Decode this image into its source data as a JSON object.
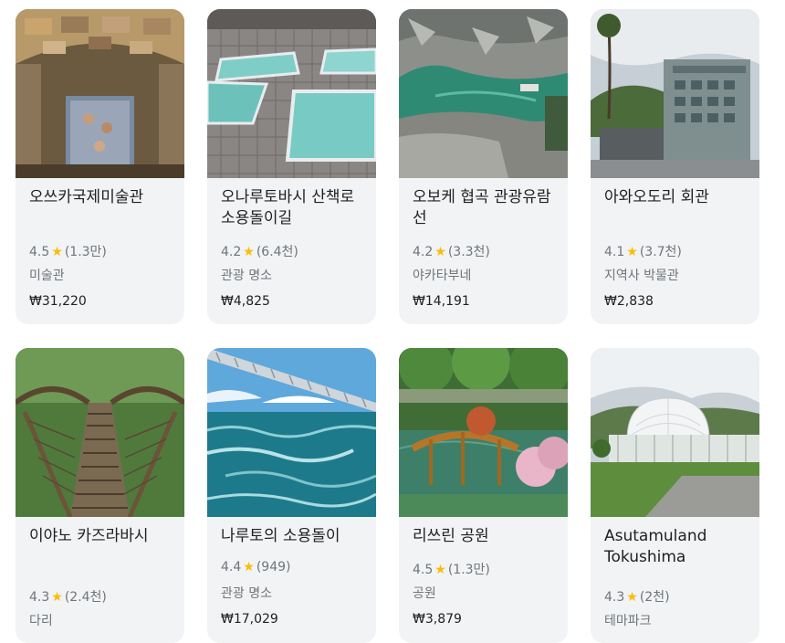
{
  "cards": [
    {
      "title": "오쓰카국제미술관",
      "rating": "4.5",
      "reviews": "(1.3만)",
      "category": "미술관",
      "price": "₩31,220",
      "image": "painted-ceiling-gallery"
    },
    {
      "title": "오나루토바시 산책로 소용돌이길",
      "rating": "4.2",
      "reviews": "(6.4천)",
      "category": "관광 명소",
      "price": "₩4,825",
      "image": "glass-floor-walkway"
    },
    {
      "title": "오보케 협곡 관광유람선",
      "rating": "4.2",
      "reviews": "(3.3천)",
      "category": "야카타부네",
      "price": "₩14,191",
      "image": "river-gorge-boat"
    },
    {
      "title": "아와오도리 회관",
      "rating": "4.1",
      "reviews": "(3.7천)",
      "category": "지역사 박물관",
      "price": "₩2,838",
      "image": "modern-building"
    },
    {
      "title": "이야노 카즈라바시",
      "rating": "4.3",
      "reviews": "(2.4천)",
      "category": "다리",
      "price": "",
      "image": "vine-bridge"
    },
    {
      "title": "나루토의 소용돌이",
      "rating": "4.4",
      "reviews": "(949)",
      "category": "관광 명소",
      "price": "₩17,029",
      "image": "suspension-bridge-sea"
    },
    {
      "title": "리쓰린 공원",
      "rating": "4.5",
      "reviews": "(1.3만)",
      "category": "공원",
      "price": "₩3,879",
      "image": "garden-arch-bridge"
    },
    {
      "title": "Asutamuland Tokushima",
      "rating": "4.3",
      "reviews": "(2천)",
      "category": "테마파크",
      "price": "",
      "image": "dome-planetarium"
    }
  ],
  "star_glyph": "★",
  "colors": {
    "card_bg": "#f1f3f4",
    "star": "#fbbc04",
    "title": "#202124",
    "meta": "#70757a"
  }
}
